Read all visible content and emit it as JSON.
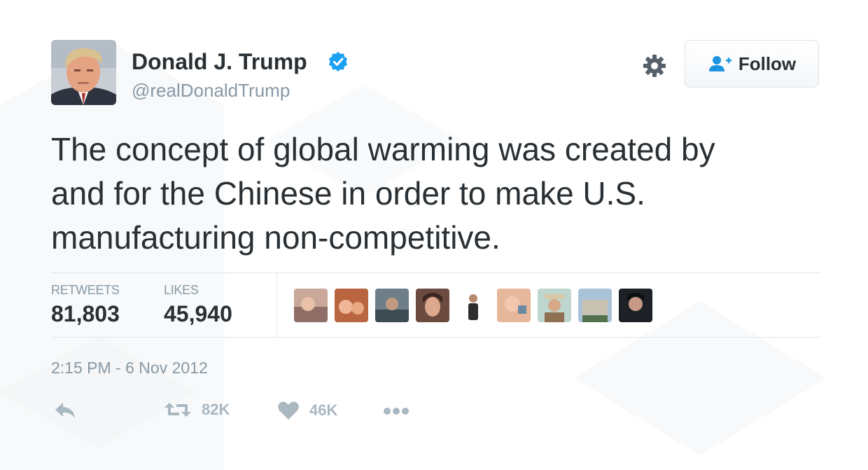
{
  "user": {
    "display_name": "Donald J. Trump",
    "handle": "@realDonaldTrump",
    "verified": true
  },
  "follow_button": {
    "label": "Follow",
    "icon": "follow-user-icon"
  },
  "settings_icon": "gear-icon",
  "tweet": {
    "text_lines": [
      "The concept of global warming was created by",
      "and for the Chinese in order to make U.S.",
      "manufacturing non-competitive."
    ]
  },
  "stats": {
    "retweets_label": "RETWEETS",
    "retweets_value": "81,803",
    "likes_label": "LIKES",
    "likes_value": "45,940"
  },
  "likers_count_shown": 9,
  "timestamp": "2:15 PM - 6 Nov 2012",
  "actions": {
    "reply_icon": "reply-icon",
    "retweet_icon": "retweet-icon",
    "retweet_count": "82K",
    "like_icon": "heart-icon",
    "like_count": "46K",
    "more_icon": "more-dots-icon"
  },
  "colors": {
    "text": "#292f33",
    "secondary": "#8899a6",
    "verified_blue": "#1da1f2",
    "follow_icon_blue": "#1b95e0",
    "action_gray": "#aab8c2",
    "divider": "#e1e8ed"
  }
}
